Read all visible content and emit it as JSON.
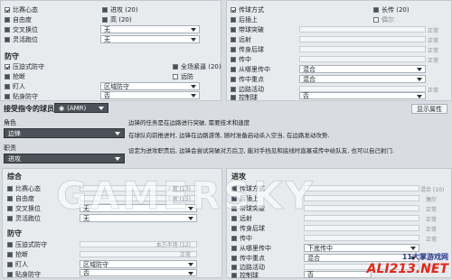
{
  "top_left": {
    "rows": [
      {
        "label": "比赛心态",
        "state": "on",
        "sub_check": "dark",
        "value": "进攻 (20)"
      },
      {
        "label": "自由度",
        "state": "dark",
        "sub_check": "dark",
        "value": "高 (20)"
      },
      {
        "label": "交叉换位",
        "state": "dark",
        "value": "无"
      },
      {
        "label": "灵活跑位",
        "state": "dark",
        "value": "无"
      }
    ],
    "defense_title": "防守",
    "defense_rows": [
      {
        "label": "压迫式防守",
        "state": "on",
        "sub_label": "全场紧逼 (20)"
      },
      {
        "label": "抢断",
        "state": "dark",
        "sub_label": "远防"
      },
      {
        "label": "盯人",
        "state": "dark",
        "value": "区域防守"
      },
      {
        "label": "贴身防守",
        "state": "dark",
        "value": "否"
      }
    ]
  },
  "top_right": {
    "rows": [
      {
        "label": "传球方式",
        "state": "on",
        "value": "长传 (20)"
      },
      {
        "label": "后插上",
        "state": "dark",
        "value": "偶尔"
      },
      {
        "label": "带球突破",
        "state": "dark",
        "value": "正常"
      },
      {
        "label": "远射",
        "state": "dark",
        "value": "正常"
      },
      {
        "label": "传身后球",
        "state": "dark",
        "value": "正常"
      },
      {
        "label": "传中",
        "state": "dark",
        "value": "正常"
      },
      {
        "label": "从哪里传中",
        "state": "dark",
        "value": "混合"
      },
      {
        "label": "传中重点",
        "state": "dark",
        "value": "混合"
      },
      {
        "label": "边路活动",
        "state": "dark",
        "value": "正常"
      },
      {
        "label": "控制球",
        "state": "dark",
        "value": "否"
      }
    ]
  },
  "instruction_bar": {
    "label": "接受指令的球员:",
    "player": "(AMR)",
    "show_attrs": "显示属性"
  },
  "role": {
    "role_label": "角色",
    "role_value": "边锋",
    "duty_label": "职责",
    "duty_value": "进攻",
    "desc1": "边锋的任务是在边路进行突破, 需要技术和速度",
    "desc2": "在球队向前推进时, 边锋在边路游荡, 随时准备启动杀入空当, 在边路发动攻势.",
    "desc3": "设定为进攻职责后, 边锋会尝试突破对方后卫, 能对手挡见和底线时直塞或传中给队友, 也可以自己射门."
  },
  "bottom_left": {
    "title": "综合",
    "rows": [
      {
        "label": "比赛心态",
        "value": "正常 (13)"
      },
      {
        "label": "自由度",
        "value": "正常 (15)"
      },
      {
        "label": "交叉换位",
        "value": "无"
      },
      {
        "label": "灵活跑位",
        "value": "无"
      }
    ],
    "defense_title": "防守",
    "defense_rows": [
      {
        "label": "压迫式防守",
        "value": "本方半场 (12)"
      },
      {
        "label": "抢断",
        "value": "正常"
      },
      {
        "label": "盯人",
        "value": "区域防守"
      },
      {
        "label": "贴身防守",
        "value": "否"
      }
    ]
  },
  "bottom_right": {
    "title": "进攻",
    "rows": [
      {
        "label": "传球方式",
        "value": "混合 (10)"
      },
      {
        "label": "后插上",
        "value": "偶尔"
      },
      {
        "label": "带球突破",
        "value": "正常"
      },
      {
        "label": "远射",
        "value": "正常"
      },
      {
        "label": "传身后球",
        "value": "正常"
      },
      {
        "label": "传中",
        "value": "正常"
      },
      {
        "label": "从哪里传中",
        "value": "下底传中"
      },
      {
        "label": "传中重点",
        "value": "混合"
      },
      {
        "label": "边路活动",
        "value": "正常"
      },
      {
        "label": "控制球",
        "value": "否"
      }
    ]
  },
  "watermark": "GAMERSKY",
  "logo": {
    "top": "11大掌游戏网",
    "big": "ALI213.NET"
  }
}
